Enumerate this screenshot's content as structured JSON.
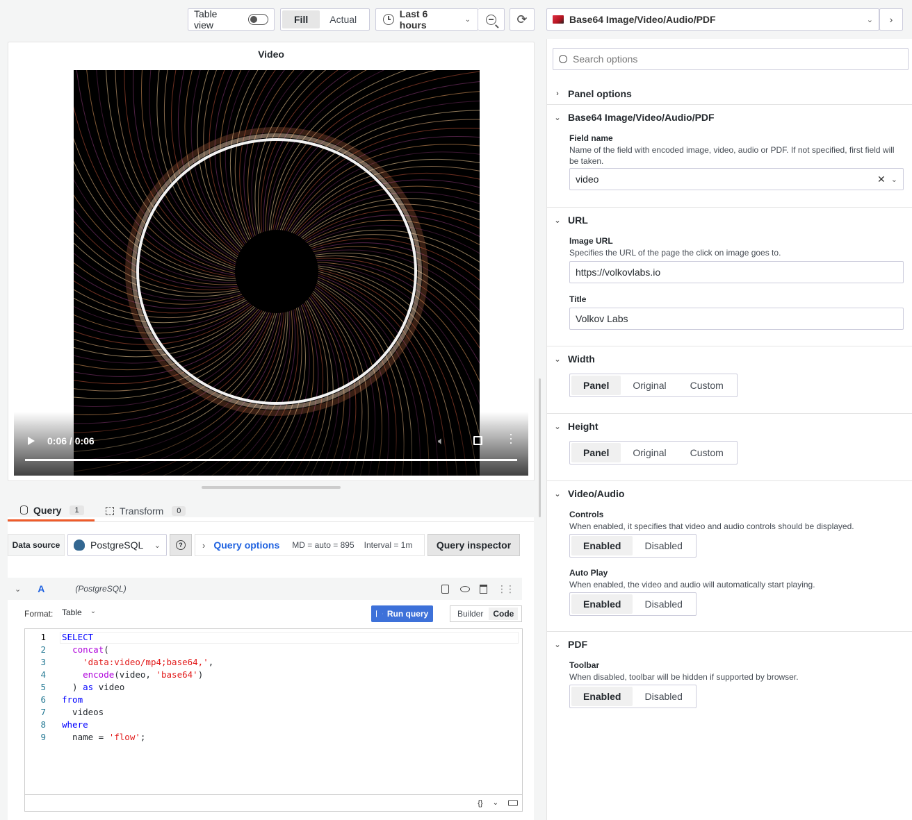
{
  "toolbar": {
    "table_view": "Table view",
    "fill": "Fill",
    "actual": "Actual",
    "time_range": "Last 6 hours",
    "visualization": "Base64 Image/Video/Audio/PDF"
  },
  "panel": {
    "title": "Video",
    "video_time": "0:06 / 0:06",
    "progress": 1.0
  },
  "query_tabs": [
    {
      "label": "Query",
      "count": "1"
    },
    {
      "label": "Transform",
      "count": "0"
    }
  ],
  "query_bar": {
    "data_source_label": "Data source",
    "data_source": "PostgreSQL",
    "query_options": "Query options",
    "md": "MD = auto = 895",
    "interval": "Interval = 1m",
    "inspector": "Query inspector"
  },
  "query": {
    "ref": "A",
    "ds": "(PostgreSQL)",
    "format_label": "Format:",
    "format_value": "Table",
    "run": "Run query",
    "builder": "Builder",
    "code": "Code",
    "lines": [
      {
        "n": "1",
        "parts": [
          {
            "t": "SELECT",
            "c": "kw"
          }
        ]
      },
      {
        "n": "2",
        "parts": [
          {
            "t": "  ",
            "c": ""
          },
          {
            "t": "concat",
            "c": "fn"
          },
          {
            "t": "(",
            "c": ""
          }
        ]
      },
      {
        "n": "3",
        "parts": [
          {
            "t": "    ",
            "c": ""
          },
          {
            "t": "'data:video/mp4;base64,'",
            "c": "str"
          },
          {
            "t": ",",
            "c": ""
          }
        ]
      },
      {
        "n": "4",
        "parts": [
          {
            "t": "    ",
            "c": ""
          },
          {
            "t": "encode",
            "c": "fn"
          },
          {
            "t": "(video, ",
            "c": ""
          },
          {
            "t": "'base64'",
            "c": "str"
          },
          {
            "t": ")",
            "c": ""
          }
        ]
      },
      {
        "n": "5",
        "parts": [
          {
            "t": "  ) ",
            "c": ""
          },
          {
            "t": "as",
            "c": "kw"
          },
          {
            "t": " video",
            "c": ""
          }
        ]
      },
      {
        "n": "6",
        "parts": [
          {
            "t": "from",
            "c": "kw"
          }
        ]
      },
      {
        "n": "7",
        "parts": [
          {
            "t": "  videos",
            "c": ""
          }
        ]
      },
      {
        "n": "8",
        "parts": [
          {
            "t": "where",
            "c": "kw"
          }
        ]
      },
      {
        "n": "9",
        "parts": [
          {
            "t": "  name = ",
            "c": ""
          },
          {
            "t": "'flow'",
            "c": "str"
          },
          {
            "t": ";",
            "c": ""
          }
        ]
      }
    ],
    "footer_braces": "{}"
  },
  "options": {
    "search_placeholder": "Search options",
    "panel_options": "Panel options",
    "base64_section": "Base64 Image/Video/Audio/PDF",
    "field_name_label": "Field name",
    "field_name_desc": "Name of the field with encoded image, video, audio or PDF. If not specified, first field will be taken.",
    "field_name_value": "video",
    "url_section": "URL",
    "image_url_label": "Image URL",
    "image_url_desc": "Specifies the URL of the page the click on image goes to.",
    "image_url_value": "https://volkovlabs.io",
    "title_label": "Title",
    "title_value": "Volkov Labs",
    "width_section": "Width",
    "height_section": "Height",
    "size_options": [
      "Panel",
      "Original",
      "Custom"
    ],
    "video_section": "Video/Audio",
    "controls_label": "Controls",
    "controls_desc": "When enabled, it specifies that video and audio controls should be displayed.",
    "autoplay_label": "Auto Play",
    "autoplay_desc": "When enabled, the video and audio will automatically start playing.",
    "pdf_section": "PDF",
    "toolbar_label": "Toolbar",
    "toolbar_desc": "When disabled, toolbar will be hidden if supported by browser.",
    "toggle_options": [
      "Enabled",
      "Disabled"
    ]
  }
}
